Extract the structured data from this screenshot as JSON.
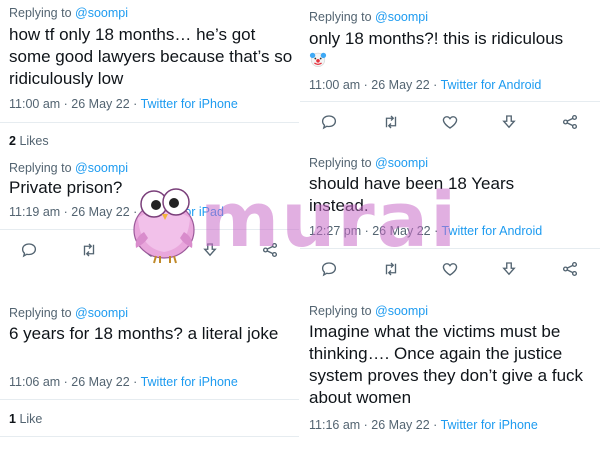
{
  "left": {
    "tweet1": {
      "reply_prefix": "Replying to",
      "handle": "@soompi",
      "text": "how tf only 18 months… he’s got some good lawyers because that’s so ridiculously low",
      "time": "11:00 am · 26 May 22 ·",
      "source": "Twitter for iPhone",
      "likes_count": "2",
      "likes_label": "Likes"
    },
    "tweet2": {
      "reply_prefix": "Replying to",
      "handle": "@soompi",
      "text": "Private prison?",
      "time": "11:19 am · 26 May 22 ·",
      "source": "Twitter for iPad"
    },
    "tweet3": {
      "reply_prefix": "Replying to",
      "handle": "@soompi",
      "text": "6 years for 18 months? a literal joke",
      "time": "11:06 am · 26 May 22 ·",
      "source": "Twitter for iPhone",
      "likes_count": "1",
      "likes_label": "Like"
    }
  },
  "right": {
    "tweet1": {
      "reply_prefix": "Replying to",
      "handle": "@soompi",
      "text": "only 18 months?! this is ridiculous",
      "emoji": "clown-face",
      "time": "11:00 am · 26 May 22 ·",
      "source": "Twitter for Android"
    },
    "tweet2": {
      "reply_prefix": "Replying to",
      "handle": "@soompi",
      "text": "should have been 18 Years instead.",
      "time": "12:27 pm · 26 May 22 ·",
      "source": "Twitter for Android"
    },
    "tweet3": {
      "reply_prefix": "Replying to",
      "handle": "@soompi",
      "text": "Imagine what the victims must be thinking…. Once again the justice system proves they don’t give a fuck about women",
      "time": "11:16 am · 26 May 22 ·",
      "source": "Twitter for iPhone"
    }
  },
  "watermark": {
    "text": "murai",
    "logo": "owl-mascot",
    "color": "#c86ec8"
  },
  "icons": [
    "reply-icon",
    "retweet-icon",
    "like-icon",
    "download-icon",
    "share-icon"
  ],
  "colors": {
    "link": "#1d9bf0",
    "meta": "#536471",
    "text": "#0f1419",
    "divider": "#e6ecf0"
  }
}
